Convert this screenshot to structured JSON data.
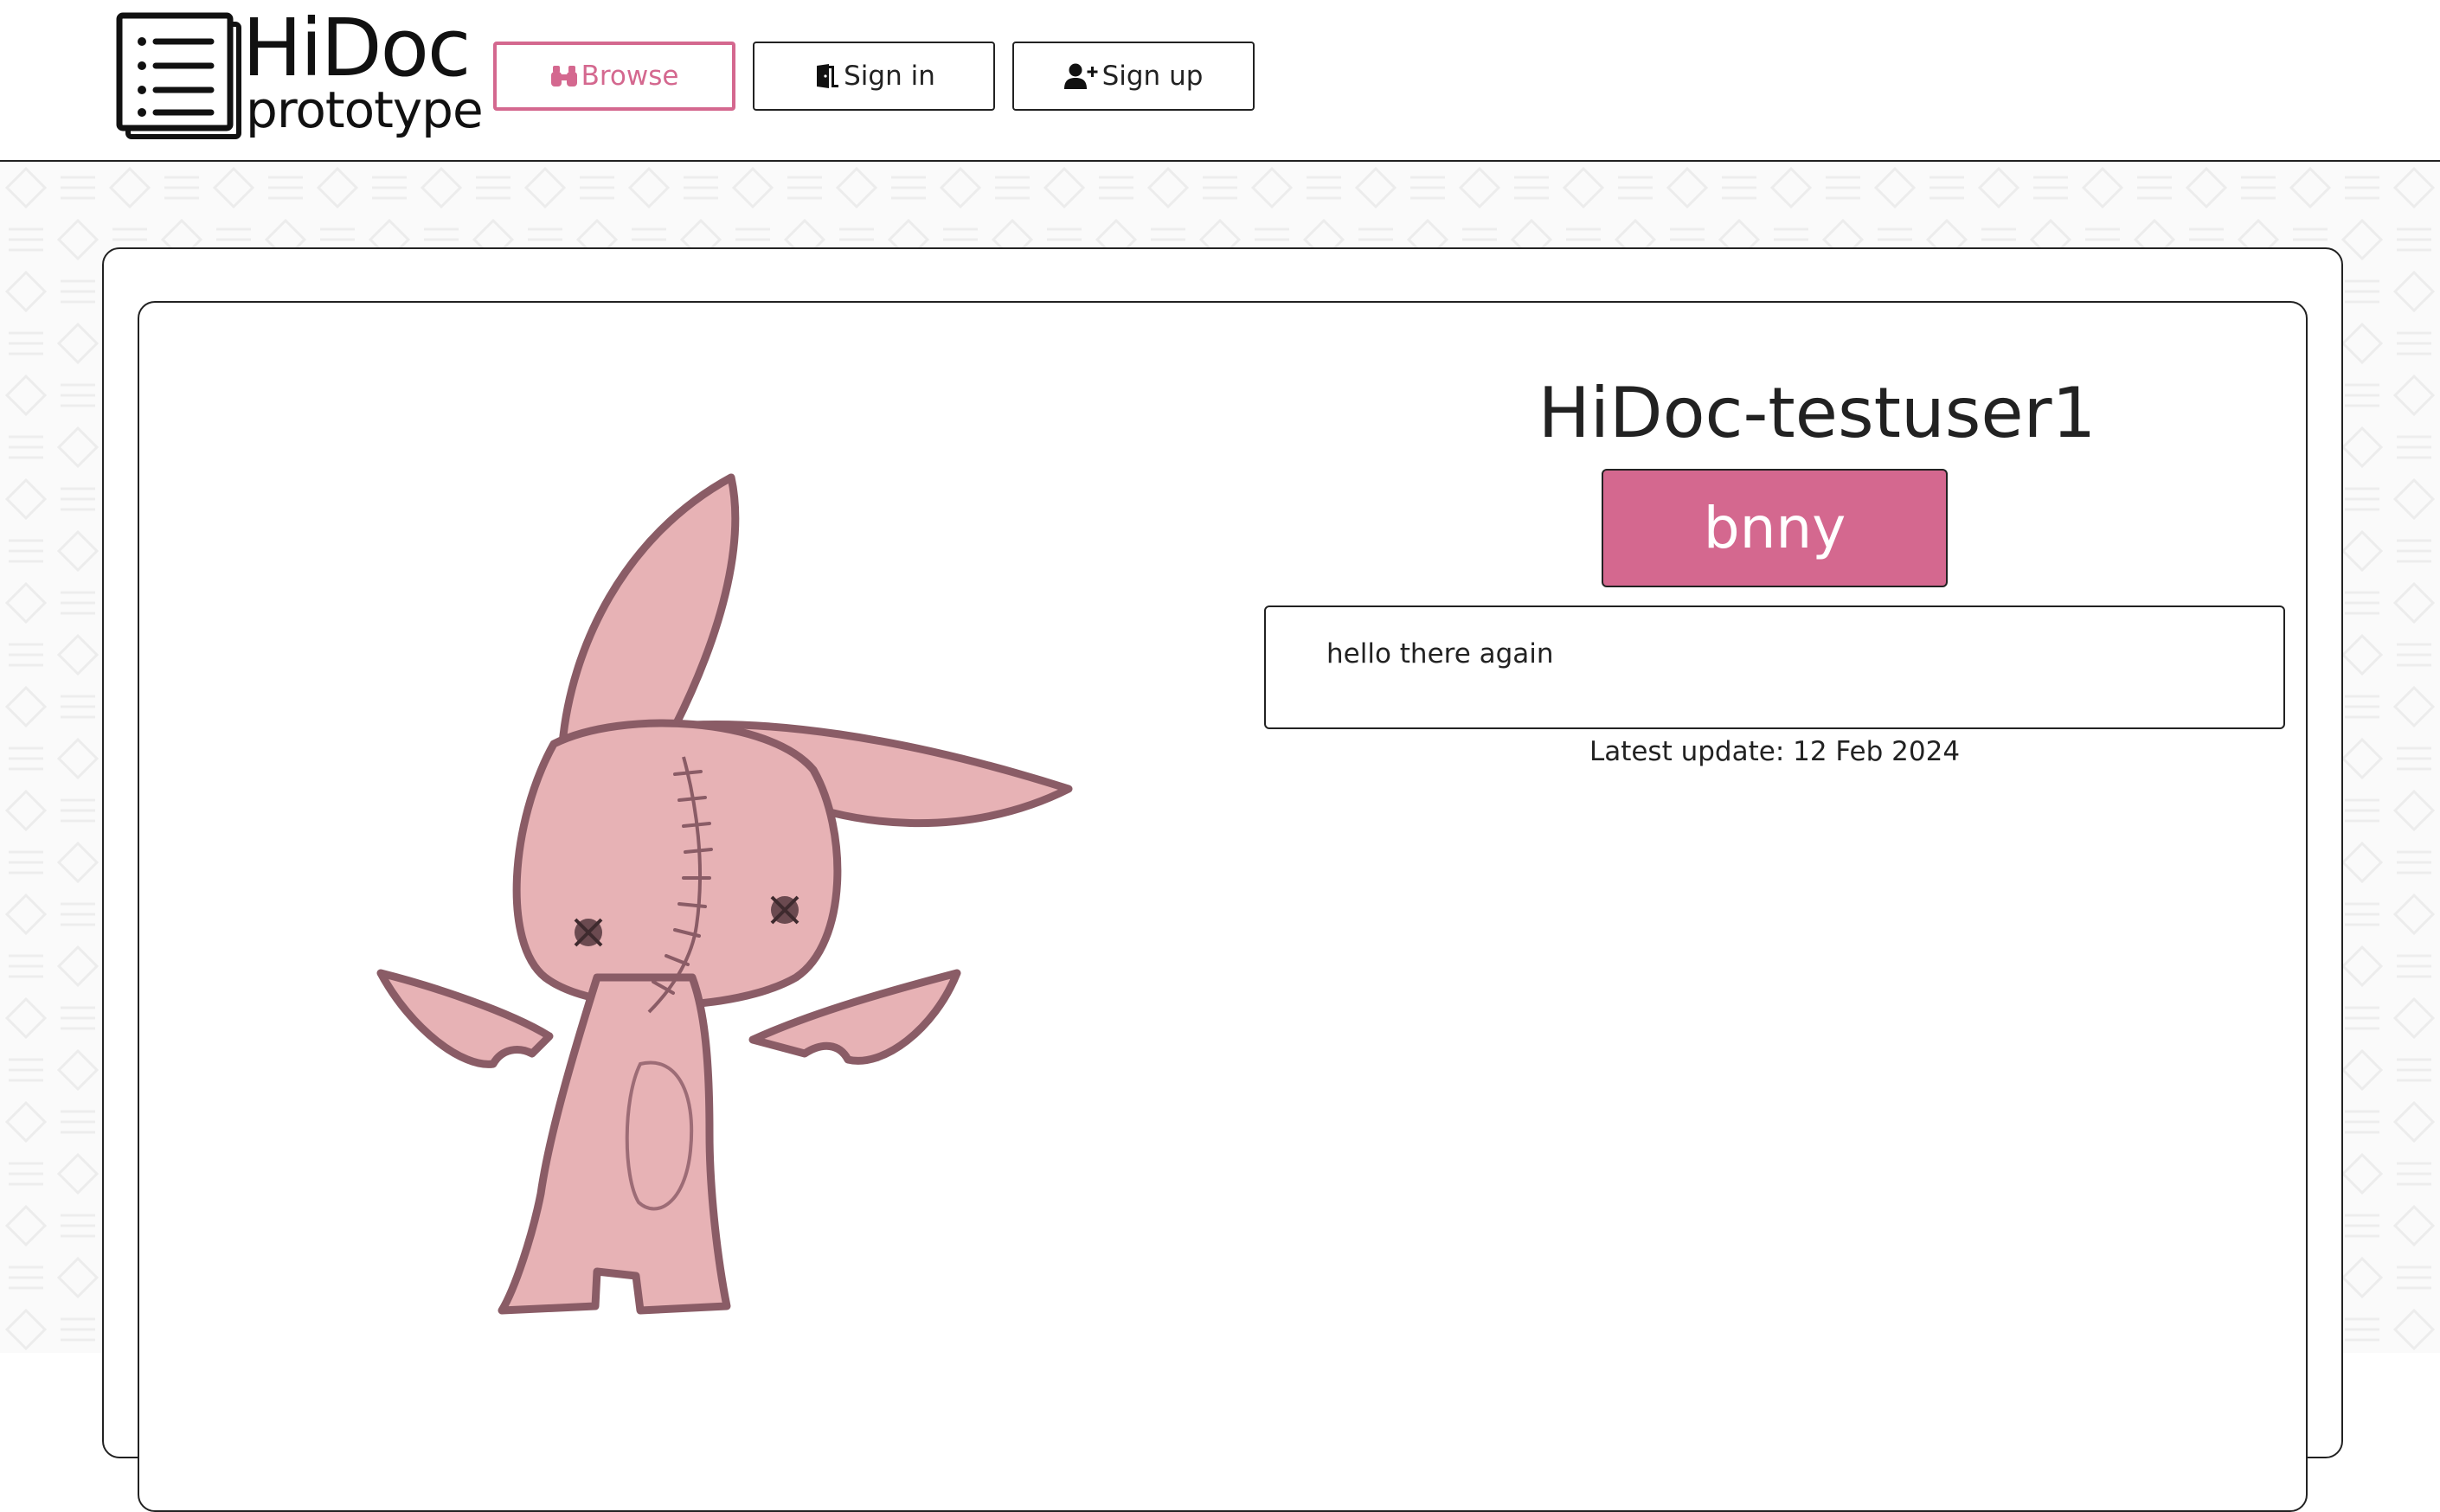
{
  "header": {
    "logo_title": "HiDoc",
    "logo_subtitle": "prototype",
    "nav": {
      "browse_label": "Browse",
      "signin_label": "Sign in",
      "signup_label": "Sign up"
    }
  },
  "profile": {
    "username": "HiDoc-testuser1",
    "tag_label": "bnny",
    "bio": "hello there again",
    "latest_update": "Latest update: 12 Feb 2024",
    "image_subject": "pink stitched bunny with wings"
  },
  "icons": {
    "browse": "binoculars-icon",
    "signin": "door-icon",
    "signup": "user-plus-icon",
    "logo": "document-list-icon"
  },
  "colors": {
    "accent": "#d4688f",
    "border": "#222222",
    "bunny_fill": "#e7b2b5",
    "bunny_stroke": "#8a5c66"
  }
}
